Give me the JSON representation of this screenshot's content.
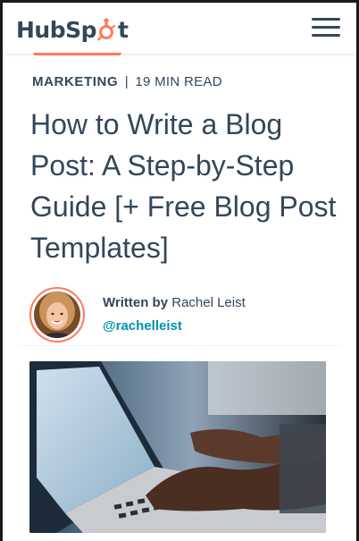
{
  "header": {
    "logo_text_left": "HubSp",
    "logo_text_right": "t",
    "brand_color": "#ff7a59",
    "menu_icon": "hamburger-menu-icon"
  },
  "article": {
    "category": "Marketing",
    "separator": "|",
    "read_time": "19 MIN READ",
    "title": "How to Write a Blog Post: A Step-by-Step Guide [+ Free Blog Post Templates]",
    "author": {
      "written_label": "Written by",
      "name": "Rachel Leist",
      "handle": "@rachelleist"
    }
  },
  "colors": {
    "text": "#33475b",
    "accent": "#ff7a59",
    "link": "#0091ae"
  }
}
